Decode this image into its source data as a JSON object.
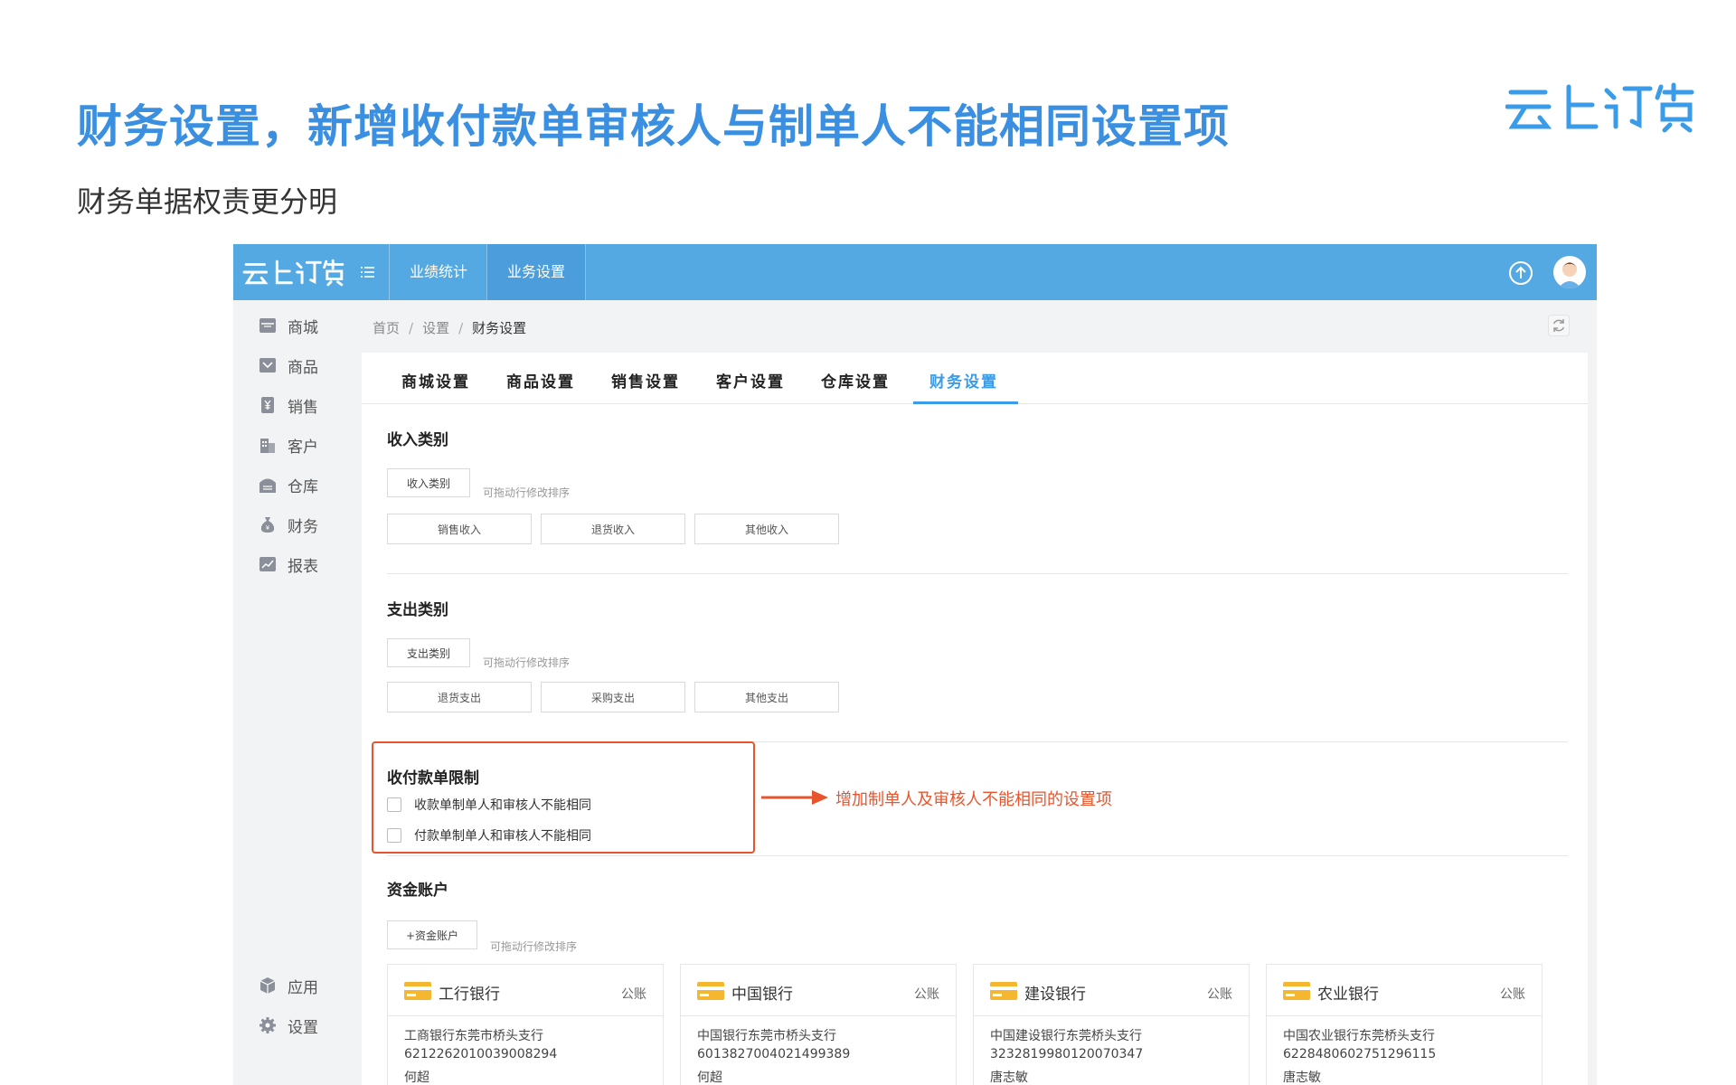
{
  "slide": {
    "title": "财务设置，新增收付款单审核人与制单人不能相同设置项",
    "subtitle": "财务单据权责更分明",
    "brand_logo_text": "云上订货"
  },
  "topbar": {
    "logo_text": "云上订货",
    "tabs": [
      {
        "label": "业绩统计"
      },
      {
        "label": "业务设置"
      }
    ]
  },
  "sidebar": {
    "items": [
      {
        "label": "商城",
        "icon": "store-icon"
      },
      {
        "label": "商品",
        "icon": "goods-icon"
      },
      {
        "label": "销售",
        "icon": "yen-icon"
      },
      {
        "label": "客户",
        "icon": "building-icon"
      },
      {
        "label": "仓库",
        "icon": "warehouse-icon"
      },
      {
        "label": "财务",
        "icon": "money-bag-icon"
      },
      {
        "label": "报表",
        "icon": "chart-icon"
      }
    ],
    "bottom_items": [
      {
        "label": "应用",
        "icon": "cube-icon"
      },
      {
        "label": "设置",
        "icon": "gear-icon"
      }
    ]
  },
  "breadcrumb": {
    "items": [
      "首页",
      "设置",
      "财务设置"
    ],
    "separator": "/"
  },
  "tabs": [
    {
      "label": "商城设置"
    },
    {
      "label": "商品设置"
    },
    {
      "label": "销售设置"
    },
    {
      "label": "客户设置"
    },
    {
      "label": "仓库设置"
    },
    {
      "label": "财务设置"
    }
  ],
  "income": {
    "title": "收入类别",
    "button": "收入类别",
    "hint": "可拖动行修改排序",
    "categories": [
      "销售收入",
      "退货收入",
      "其他收入"
    ]
  },
  "expense": {
    "title": "支出类别",
    "button": "支出类别",
    "hint": "可拖动行修改排序",
    "categories": [
      "退货支出",
      "采购支出",
      "其他支出"
    ]
  },
  "restriction": {
    "title": "收付款单限制",
    "options": [
      {
        "label": "收款单制单人和审核人不能相同",
        "checked": false
      },
      {
        "label": "付款单制单人和审核人不能相同",
        "checked": false
      }
    ],
    "annotation": "增加制单人及审核人不能相同的设置项"
  },
  "accounts": {
    "title": "资金账户",
    "button": "+资金账户",
    "hint": "可拖动行修改排序",
    "cards": [
      {
        "name": "工行银行",
        "type": "公账",
        "branch": "工商银行东莞市桥头支行",
        "number": "6212262010039008294",
        "holder": "何超"
      },
      {
        "name": "中国银行",
        "type": "公账",
        "branch": "中国银行东莞市桥头支行",
        "number": "6013827004021499389",
        "holder": "何超"
      },
      {
        "name": "建设银行",
        "type": "公账",
        "branch": "中国建设银行东莞桥头支行",
        "number": "3232819980120070347",
        "holder": "唐志敏"
      },
      {
        "name": "农业银行",
        "type": "公账",
        "branch": "中国农业银行东莞桥头支行",
        "number": "6228480602751296115",
        "holder": "唐志敏"
      }
    ]
  },
  "colors": {
    "title_blue": "#3a8fe0",
    "topbar_blue": "#55a9e3",
    "accent_blue": "#3a9be8",
    "highlight_red": "#e8542c",
    "card_yellow": "#f5b730"
  }
}
